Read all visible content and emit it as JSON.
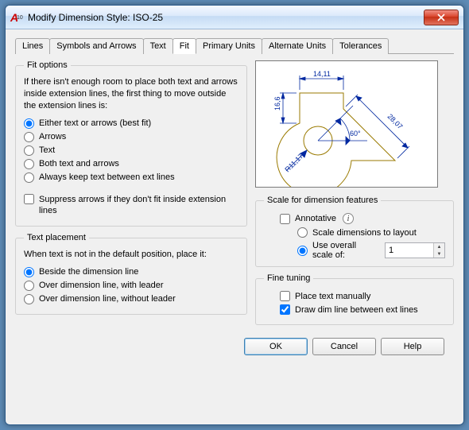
{
  "window": {
    "title": "Modify Dimension Style: ISO-25"
  },
  "tabs": {
    "lines": "Lines",
    "symbols": "Symbols and Arrows",
    "text": "Text",
    "fit": "Fit",
    "primary": "Primary Units",
    "alternate": "Alternate Units",
    "tolerances": "Tolerances"
  },
  "fit_options": {
    "legend": "Fit options",
    "description": "If there isn't enough room to place both text and arrows inside extension lines, the first thing to move outside the extension lines is:",
    "opt_either": "Either text or arrows (best fit)",
    "opt_arrows": "Arrows",
    "opt_text": "Text",
    "opt_both": "Both text and arrows",
    "opt_always": "Always keep text between ext lines",
    "suppress": "Suppress arrows if they don't fit inside extension lines"
  },
  "text_placement": {
    "legend": "Text placement",
    "description": "When text is not in the default position, place it:",
    "opt_beside": "Beside the dimension line",
    "opt_over_leader": "Over dimension line, with leader",
    "opt_over_noleader": "Over dimension line, without leader"
  },
  "preview": {
    "dim_top": "14,11",
    "dim_left": "16,6",
    "dim_diag": "28,07",
    "dim_angle": "60°",
    "dim_radius": "R11,17"
  },
  "scale": {
    "legend": "Scale for dimension features",
    "annotative": "Annotative",
    "opt_layout": "Scale dimensions to layout",
    "opt_overall": "Use overall scale of:",
    "overall_value": "1"
  },
  "fine_tuning": {
    "legend": "Fine tuning",
    "place_manual": "Place text manually",
    "draw_dimline": "Draw dim line between ext lines"
  },
  "buttons": {
    "ok": "OK",
    "cancel": "Cancel",
    "help": "Help"
  }
}
